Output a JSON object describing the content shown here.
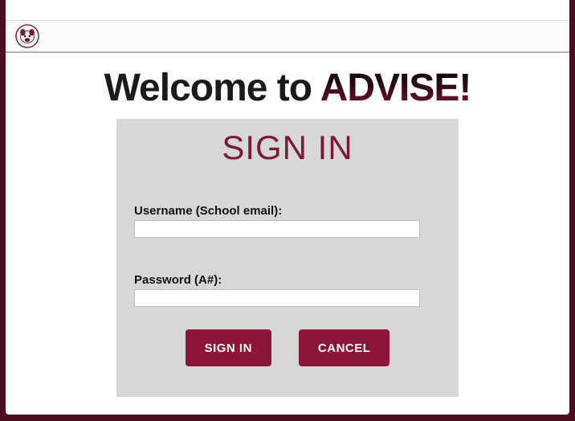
{
  "header": {
    "logo_name": "bulldog-logo"
  },
  "welcome": {
    "prefix": "Welcome to ",
    "brand": "ADVISE!"
  },
  "panel": {
    "title": "SIGN IN",
    "username_label": "Username (School email):",
    "username_value": "",
    "password_label": "Password (A#):",
    "password_value": "",
    "sign_in_label": "SIGN IN",
    "cancel_label": "CANCEL"
  }
}
